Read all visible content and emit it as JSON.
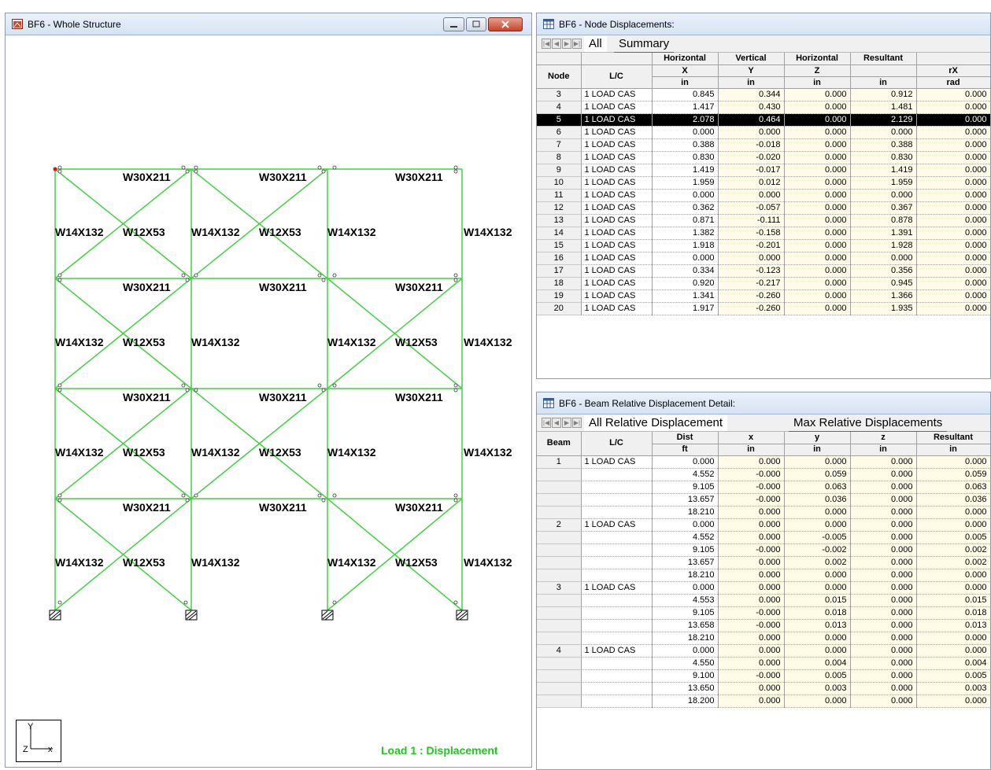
{
  "left_window": {
    "title": "BF6 - Whole Structure",
    "status_text": "Load 1 : Displacement",
    "axis_labels": {
      "y": "Y",
      "x": "x",
      "z": "Z"
    },
    "member_labels": {
      "beam": "W30X211",
      "column": "W14X132",
      "brace": "W12X53"
    }
  },
  "node_window": {
    "title": "BF6 - Node Displacements:",
    "tabs": [
      "All",
      "Summary"
    ],
    "header_group": [
      "",
      "",
      "Horizontal",
      "Vertical",
      "Horizontal",
      "Resultant",
      ""
    ],
    "columns": [
      {
        "name": "Node",
        "unit": ""
      },
      {
        "name": "L/C",
        "unit": ""
      },
      {
        "name": "X",
        "unit": "in"
      },
      {
        "name": "Y",
        "unit": "in"
      },
      {
        "name": "Z",
        "unit": "in"
      },
      {
        "name": "",
        "unit": "in"
      },
      {
        "name": "rX",
        "unit": "rad"
      }
    ],
    "rows": [
      [
        "3",
        "1 LOAD CAS",
        "0.845",
        "0.344",
        "0.000",
        "0.912",
        "0.000"
      ],
      [
        "4",
        "1 LOAD CAS",
        "1.417",
        "0.430",
        "0.000",
        "1.481",
        "0.000"
      ],
      [
        "5",
        "1 LOAD CAS",
        "2.078",
        "0.464",
        "0.000",
        "2.129",
        "0.000"
      ],
      [
        "6",
        "1 LOAD CAS",
        "0.000",
        "0.000",
        "0.000",
        "0.000",
        "0.000"
      ],
      [
        "7",
        "1 LOAD CAS",
        "0.388",
        "-0.018",
        "0.000",
        "0.388",
        "0.000"
      ],
      [
        "8",
        "1 LOAD CAS",
        "0.830",
        "-0.020",
        "0.000",
        "0.830",
        "0.000"
      ],
      [
        "9",
        "1 LOAD CAS",
        "1.419",
        "-0.017",
        "0.000",
        "1.419",
        "0.000"
      ],
      [
        "10",
        "1 LOAD CAS",
        "1.959",
        "0.012",
        "0.000",
        "1.959",
        "0.000"
      ],
      [
        "11",
        "1 LOAD CAS",
        "0.000",
        "0.000",
        "0.000",
        "0.000",
        "0.000"
      ],
      [
        "12",
        "1 LOAD CAS",
        "0.362",
        "-0.057",
        "0.000",
        "0.367",
        "0.000"
      ],
      [
        "13",
        "1 LOAD CAS",
        "0.871",
        "-0.111",
        "0.000",
        "0.878",
        "0.000"
      ],
      [
        "14",
        "1 LOAD CAS",
        "1.382",
        "-0.158",
        "0.000",
        "1.391",
        "0.000"
      ],
      [
        "15",
        "1 LOAD CAS",
        "1.918",
        "-0.201",
        "0.000",
        "1.928",
        "0.000"
      ],
      [
        "16",
        "1 LOAD CAS",
        "0.000",
        "0.000",
        "0.000",
        "0.000",
        "0.000"
      ],
      [
        "17",
        "1 LOAD CAS",
        "0.334",
        "-0.123",
        "0.000",
        "0.356",
        "0.000"
      ],
      [
        "18",
        "1 LOAD CAS",
        "0.920",
        "-0.217",
        "0.000",
        "0.945",
        "0.000"
      ],
      [
        "19",
        "1 LOAD CAS",
        "1.341",
        "-0.260",
        "0.000",
        "1.366",
        "0.000"
      ],
      [
        "20",
        "1 LOAD CAS",
        "1.917",
        "-0.260",
        "0.000",
        "1.935",
        "0.000"
      ]
    ],
    "selected_node": "5"
  },
  "beam_window": {
    "title": "BF6 - Beam Relative Displacement Detail:",
    "tabs": [
      "All Relative Displacement",
      "Max Relative Displacements"
    ],
    "columns": [
      {
        "name": "Beam",
        "unit": ""
      },
      {
        "name": "L/C",
        "unit": ""
      },
      {
        "name": "Dist",
        "unit": "ft"
      },
      {
        "name": "x",
        "unit": "in"
      },
      {
        "name": "y",
        "unit": "in"
      },
      {
        "name": "z",
        "unit": "in"
      },
      {
        "name": "Resultant",
        "unit": "in"
      }
    ],
    "rows": [
      [
        "1",
        "1 LOAD CAS",
        "0.000",
        "0.000",
        "0.000",
        "0.000",
        "0.000"
      ],
      [
        "",
        "",
        "4.552",
        "-0.000",
        "0.059",
        "0.000",
        "0.059"
      ],
      [
        "",
        "",
        "9.105",
        "-0.000",
        "0.063",
        "0.000",
        "0.063"
      ],
      [
        "",
        "",
        "13.657",
        "-0.000",
        "0.036",
        "0.000",
        "0.036"
      ],
      [
        "",
        "",
        "18.210",
        "0.000",
        "0.000",
        "0.000",
        "0.000"
      ],
      [
        "2",
        "1 LOAD CAS",
        "0.000",
        "0.000",
        "0.000",
        "0.000",
        "0.000"
      ],
      [
        "",
        "",
        "4.552",
        "0.000",
        "-0.005",
        "0.000",
        "0.005"
      ],
      [
        "",
        "",
        "9.105",
        "-0.000",
        "-0.002",
        "0.000",
        "0.002"
      ],
      [
        "",
        "",
        "13.657",
        "0.000",
        "0.002",
        "0.000",
        "0.002"
      ],
      [
        "",
        "",
        "18.210",
        "0.000",
        "0.000",
        "0.000",
        "0.000"
      ],
      [
        "3",
        "1 LOAD CAS",
        "0.000",
        "0.000",
        "0.000",
        "0.000",
        "0.000"
      ],
      [
        "",
        "",
        "4.553",
        "0.000",
        "0.015",
        "0.000",
        "0.015"
      ],
      [
        "",
        "",
        "9.105",
        "-0.000",
        "0.018",
        "0.000",
        "0.018"
      ],
      [
        "",
        "",
        "13.658",
        "-0.000",
        "0.013",
        "0.000",
        "0.013"
      ],
      [
        "",
        "",
        "18.210",
        "0.000",
        "0.000",
        "0.000",
        "0.000"
      ],
      [
        "4",
        "1 LOAD CAS",
        "0.000",
        "0.000",
        "0.000",
        "0.000",
        "0.000"
      ],
      [
        "",
        "",
        "4.550",
        "0.000",
        "0.004",
        "0.000",
        "0.004"
      ],
      [
        "",
        "",
        "9.100",
        "-0.000",
        "0.005",
        "0.000",
        "0.005"
      ],
      [
        "",
        "",
        "13.650",
        "0.000",
        "0.003",
        "0.000",
        "0.003"
      ],
      [
        "",
        "",
        "18.200",
        "0.000",
        "0.000",
        "0.000",
        "0.000"
      ]
    ]
  }
}
